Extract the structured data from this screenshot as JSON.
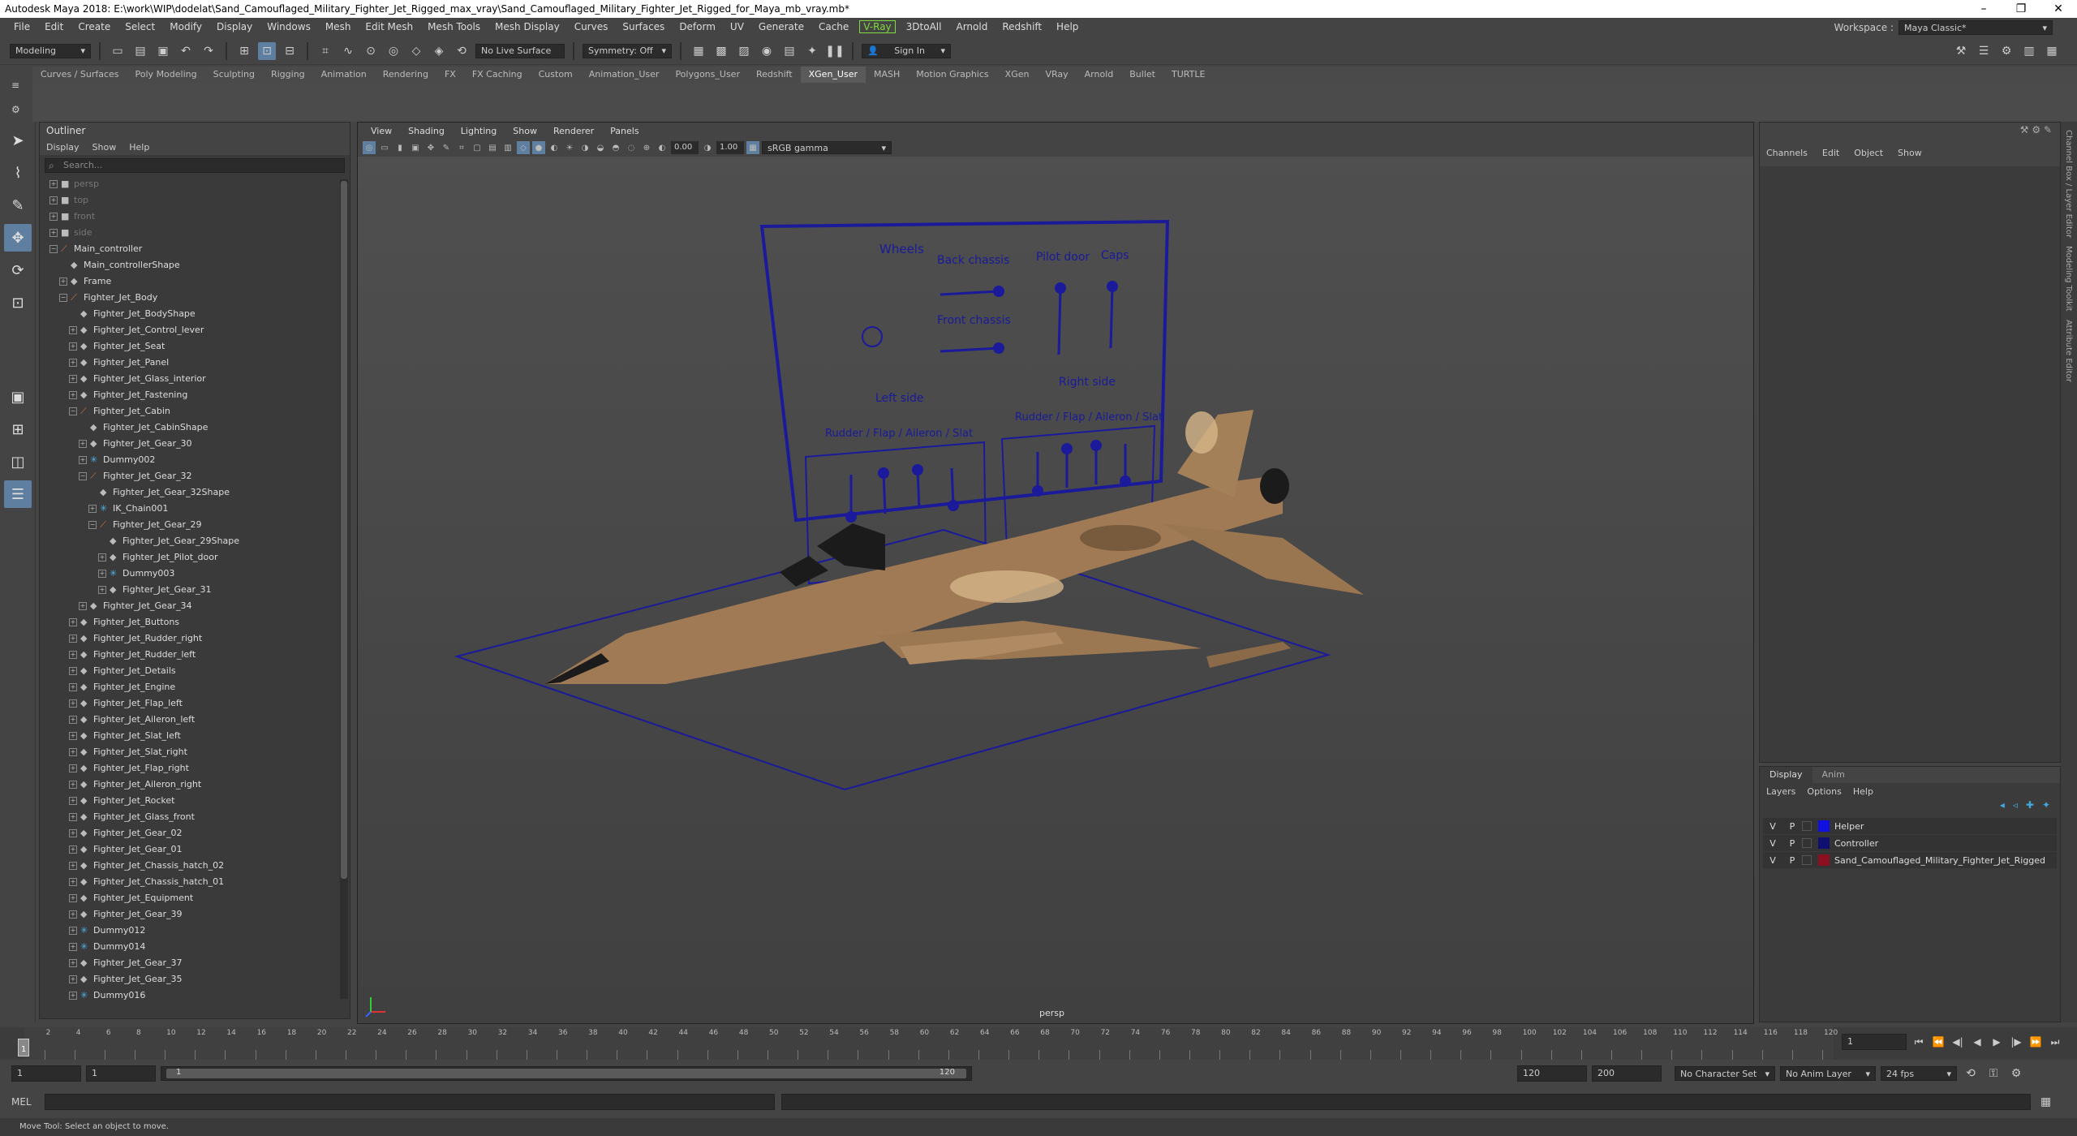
{
  "window": {
    "title": "Autodesk Maya 2018: E:\\work\\WIP\\dodelat\\Sand_Camouflaged_Military_Fighter_Jet_Rigged_max_vray\\Sand_Camouflaged_Military_Fighter_Jet_Rigged_for_Maya_mb_vray.mb*",
    "minimize": "–",
    "maximize": "❐",
    "close": "✕"
  },
  "menu": [
    "File",
    "Edit",
    "Create",
    "Select",
    "Modify",
    "Display",
    "Windows",
    "Mesh",
    "Edit Mesh",
    "Mesh Tools",
    "Mesh Display",
    "Curves",
    "Surfaces",
    "Deform",
    "UV",
    "Generate",
    "Cache",
    "V-Ray",
    "3DtoAll",
    "Arnold",
    "Redshift",
    "Help"
  ],
  "workspace": {
    "label": "Workspace :",
    "value": "Maya Classic*"
  },
  "status": {
    "mode": "Modeling",
    "live_surface": "No Live Surface",
    "symmetry": "Symmetry: Off",
    "signin": "Sign In"
  },
  "shelf_tabs": [
    "Curves / Surfaces",
    "Poly Modeling",
    "Sculpting",
    "Rigging",
    "Animation",
    "Rendering",
    "FX",
    "FX Caching",
    "Custom",
    "Animation_User",
    "Polygons_User",
    "Redshift",
    "XGen_User",
    "MASH",
    "Motion Graphics",
    "XGen",
    "VRay",
    "Arnold",
    "Bullet",
    "TURTLE"
  ],
  "shelf_active": "XGen_User",
  "outliner": {
    "title": "Outliner",
    "menu": [
      "Display",
      "Show",
      "Help"
    ],
    "search_placeholder": "Search...",
    "items": [
      {
        "label": "persp",
        "indent": 0,
        "exp": "+",
        "icon": "cam",
        "dim": true
      },
      {
        "label": "top",
        "indent": 0,
        "exp": "+",
        "icon": "cam",
        "dim": true
      },
      {
        "label": "front",
        "indent": 0,
        "exp": "+",
        "icon": "cam",
        "dim": true
      },
      {
        "label": "side",
        "indent": 0,
        "exp": "+",
        "icon": "cam",
        "dim": true
      },
      {
        "label": "Main_controller",
        "indent": 0,
        "exp": "−",
        "icon": "tr"
      },
      {
        "label": "Main_controllerShape",
        "indent": 1,
        "exp": "",
        "icon": "node"
      },
      {
        "label": "Frame",
        "indent": 1,
        "exp": "+",
        "icon": "node"
      },
      {
        "label": "Fighter_Jet_Body",
        "indent": 1,
        "exp": "−",
        "icon": "tr"
      },
      {
        "label": "Fighter_Jet_BodyShape",
        "indent": 2,
        "exp": "",
        "icon": "node"
      },
      {
        "label": "Fighter_Jet_Control_lever",
        "indent": 2,
        "exp": "+",
        "icon": "node"
      },
      {
        "label": "Fighter_Jet_Seat",
        "indent": 2,
        "exp": "+",
        "icon": "node"
      },
      {
        "label": "Fighter_Jet_Panel",
        "indent": 2,
        "exp": "+",
        "icon": "node"
      },
      {
        "label": "Fighter_Jet_Glass_interior",
        "indent": 2,
        "exp": "+",
        "icon": "node"
      },
      {
        "label": "Fighter_Jet_Fastening",
        "indent": 2,
        "exp": "+",
        "icon": "node"
      },
      {
        "label": "Fighter_Jet_Cabin",
        "indent": 2,
        "exp": "−",
        "icon": "tr"
      },
      {
        "label": "Fighter_Jet_CabinShape",
        "indent": 3,
        "exp": "",
        "icon": "node"
      },
      {
        "label": "Fighter_Jet_Gear_30",
        "indent": 3,
        "exp": "+",
        "icon": "node"
      },
      {
        "label": "Dummy002",
        "indent": 3,
        "exp": "+",
        "icon": "star"
      },
      {
        "label": "Fighter_Jet_Gear_32",
        "indent": 3,
        "exp": "−",
        "icon": "tr"
      },
      {
        "label": "Fighter_Jet_Gear_32Shape",
        "indent": 4,
        "exp": "",
        "icon": "node"
      },
      {
        "label": "IK_Chain001",
        "indent": 4,
        "exp": "+",
        "icon": "star"
      },
      {
        "label": "Fighter_Jet_Gear_29",
        "indent": 4,
        "exp": "−",
        "icon": "tr"
      },
      {
        "label": "Fighter_Jet_Gear_29Shape",
        "indent": 5,
        "exp": "",
        "icon": "node"
      },
      {
        "label": "Fighter_Jet_Pilot_door",
        "indent": 5,
        "exp": "+",
        "icon": "node"
      },
      {
        "label": "Dummy003",
        "indent": 5,
        "exp": "+",
        "icon": "star"
      },
      {
        "label": "Fighter_Jet_Gear_31",
        "indent": 5,
        "exp": "+",
        "icon": "node"
      },
      {
        "label": "Fighter_Jet_Gear_34",
        "indent": 3,
        "exp": "+",
        "icon": "node"
      },
      {
        "label": "Fighter_Jet_Buttons",
        "indent": 2,
        "exp": "+",
        "icon": "node"
      },
      {
        "label": "Fighter_Jet_Rudder_right",
        "indent": 2,
        "exp": "+",
        "icon": "node"
      },
      {
        "label": "Fighter_Jet_Rudder_left",
        "indent": 2,
        "exp": "+",
        "icon": "node"
      },
      {
        "label": "Fighter_Jet_Details",
        "indent": 2,
        "exp": "+",
        "icon": "node"
      },
      {
        "label": "Fighter_Jet_Engine",
        "indent": 2,
        "exp": "+",
        "icon": "node"
      },
      {
        "label": "Fighter_Jet_Flap_left",
        "indent": 2,
        "exp": "+",
        "icon": "node"
      },
      {
        "label": "Fighter_Jet_Aileron_left",
        "indent": 2,
        "exp": "+",
        "icon": "node"
      },
      {
        "label": "Fighter_Jet_Slat_left",
        "indent": 2,
        "exp": "+",
        "icon": "node"
      },
      {
        "label": "Fighter_Jet_Slat_right",
        "indent": 2,
        "exp": "+",
        "icon": "node"
      },
      {
        "label": "Fighter_Jet_Flap_right",
        "indent": 2,
        "exp": "+",
        "icon": "node"
      },
      {
        "label": "Fighter_Jet_Aileron_right",
        "indent": 2,
        "exp": "+",
        "icon": "node"
      },
      {
        "label": "Fighter_Jet_Rocket",
        "indent": 2,
        "exp": "+",
        "icon": "node"
      },
      {
        "label": "Fighter_Jet_Glass_front",
        "indent": 2,
        "exp": "+",
        "icon": "node"
      },
      {
        "label": "Fighter_Jet_Gear_02",
        "indent": 2,
        "exp": "+",
        "icon": "node"
      },
      {
        "label": "Fighter_Jet_Gear_01",
        "indent": 2,
        "exp": "+",
        "icon": "node"
      },
      {
        "label": "Fighter_Jet_Chassis_hatch_02",
        "indent": 2,
        "exp": "+",
        "icon": "node"
      },
      {
        "label": "Fighter_Jet_Chassis_hatch_01",
        "indent": 2,
        "exp": "+",
        "icon": "node"
      },
      {
        "label": "Fighter_Jet_Equipment",
        "indent": 2,
        "exp": "+",
        "icon": "node"
      },
      {
        "label": "Fighter_Jet_Gear_39",
        "indent": 2,
        "exp": "+",
        "icon": "node"
      },
      {
        "label": "Dummy012",
        "indent": 2,
        "exp": "+",
        "icon": "star"
      },
      {
        "label": "Dummy014",
        "indent": 2,
        "exp": "+",
        "icon": "star"
      },
      {
        "label": "Fighter_Jet_Gear_37",
        "indent": 2,
        "exp": "+",
        "icon": "node"
      },
      {
        "label": "Fighter_Jet_Gear_35",
        "indent": 2,
        "exp": "+",
        "icon": "node"
      },
      {
        "label": "Dummy016",
        "indent": 2,
        "exp": "+",
        "icon": "star"
      }
    ]
  },
  "viewport": {
    "menu": [
      "View",
      "Shading",
      "Lighting",
      "Show",
      "Renderer",
      "Panels"
    ],
    "exposure": "0.00",
    "gamma": "1.00",
    "colorspace": "sRGB gamma",
    "camera": "persp"
  },
  "controls": {
    "wheels": "Wheels",
    "back_chassis": "Back chassis",
    "front_chassis": "Front chassis",
    "pilot_door": "Pilot door",
    "caps": "Caps",
    "left_side": "Left side",
    "right_side": "Right side",
    "rudder_left": "Rudder / Flap / Aileron / Slat",
    "rudder_right": "Rudder / Flap / Aileron / Slat"
  },
  "channelbox": {
    "menu": [
      "Channels",
      "Edit",
      "Object",
      "Show"
    ]
  },
  "layers": {
    "tabs": [
      "Display",
      "Anim"
    ],
    "menu": [
      "Layers",
      "Options",
      "Help"
    ],
    "items": [
      {
        "v": "V",
        "p": "P",
        "name": "Helper",
        "color": "#1010e0"
      },
      {
        "v": "V",
        "p": "P",
        "name": "Controller",
        "color": "#101070"
      },
      {
        "v": "V",
        "p": "P",
        "name": "Sand_Camouflaged_Military_Fighter_Jet_Rigged",
        "color": "#8a1020"
      }
    ]
  },
  "right_tabs": [
    "Channel Box / Layer Editor",
    "Modeling Toolkit",
    "Attribute Editor"
  ],
  "timeline": {
    "ticks": [
      "2",
      "4",
      "6",
      "8",
      "10",
      "12",
      "14",
      "16",
      "18",
      "20",
      "22",
      "24",
      "26",
      "28",
      "30",
      "32",
      "34",
      "36",
      "38",
      "40",
      "42",
      "44",
      "46",
      "48",
      "50",
      "52",
      "54",
      "56",
      "58",
      "60",
      "62",
      "64",
      "66",
      "68",
      "70",
      "72",
      "74",
      "76",
      "78",
      "80",
      "82",
      "84",
      "86",
      "88",
      "90",
      "92",
      "94",
      "96",
      "98",
      "100",
      "102",
      "104",
      "106",
      "108",
      "110",
      "112",
      "114",
      "116",
      "118",
      "120"
    ],
    "current": "1",
    "current_field": "1"
  },
  "range": {
    "start": "1",
    "start2": "1",
    "inner_start": "1",
    "inner_end": "120",
    "end": "120",
    "end2": "200",
    "character_set": "No Character Set",
    "anim_layer": "No Anim Layer",
    "fps": "24 fps"
  },
  "cmd": {
    "lang": "MEL"
  },
  "help": "Move Tool: Select an object to move."
}
